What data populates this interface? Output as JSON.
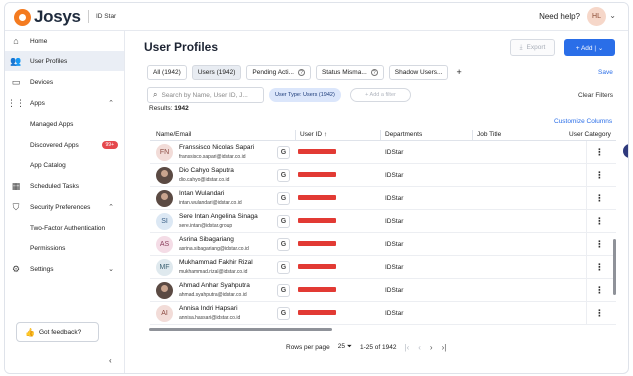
{
  "app": {
    "logo": "Josys",
    "tenant": "ID Star",
    "help": "Need help?",
    "avatar": "HL"
  },
  "sidebar": {
    "items": [
      {
        "label": "Home",
        "icon": "home-icon"
      },
      {
        "label": "User Profiles",
        "icon": "people-icon"
      },
      {
        "label": "Devices",
        "icon": "laptop-icon"
      },
      {
        "label": "Apps",
        "icon": "grid-icon"
      },
      {
        "label": "Managed Apps"
      },
      {
        "label": "Discovered Apps",
        "badge": "99+"
      },
      {
        "label": "App Catalog"
      },
      {
        "label": "Scheduled Tasks",
        "icon": "calendar-icon"
      },
      {
        "label": "Security Preferences",
        "icon": "shield-icon"
      },
      {
        "label": "Two-Factor Authentication"
      },
      {
        "label": "Permissions"
      },
      {
        "label": "Settings",
        "icon": "gear-icon"
      }
    ],
    "feedback": "Got feedback?"
  },
  "main": {
    "title": "User Profiles",
    "export_label": "Export",
    "add_label": "+ Add | ⌄",
    "tabs": [
      {
        "label": "All (1942)"
      },
      {
        "label": "Users (1942)"
      },
      {
        "label": "Pending Acti..."
      },
      {
        "label": "Status Misma..."
      },
      {
        "label": "Shadow Users..."
      }
    ],
    "save_label": "Save",
    "search_placeholder": "Search by Name, User ID, J...",
    "filter_chip": "User Type: Users (1942)",
    "add_filter": "+ Add a filter",
    "clear_filters": "Clear Filters",
    "results_label": "Results:",
    "results_count": "1942",
    "customize": "Customize Columns",
    "columns": [
      "Name/Email",
      "User ID ↑",
      "Departments",
      "Job Title",
      "User Category"
    ],
    "rows": [
      {
        "initials": "FN",
        "name": "Franssisco Nicolas Sapari",
        "email": "franssisco.sapari@idstar.co.id",
        "dept": "IDStar",
        "avatar_color": "#f2dcd8",
        "text_color": "#8b4a42"
      },
      {
        "initials": "",
        "name": "Dio Cahyo Saputra",
        "email": "dio.cahyo@idstar.co.id",
        "dept": "IDStar",
        "photo": true
      },
      {
        "initials": "",
        "name": "Intan Wulandari",
        "email": "intan.wulandari@idstar.co.id",
        "dept": "IDStar",
        "photo": true
      },
      {
        "initials": "SI",
        "name": "Sere Intan Angelina Sinaga",
        "email": "sere.intan@idstar.group",
        "dept": "IDStar",
        "avatar_color": "#dce8f4",
        "text_color": "#3a5f86"
      },
      {
        "initials": "AS",
        "name": "Asrina Sibagariang",
        "email": "asrina.sibagariang@idstar.co.id",
        "dept": "IDStar",
        "avatar_color": "#f4dce6",
        "text_color": "#8a3e5c"
      },
      {
        "initials": "MF",
        "name": "Mukhammad Fakhir Rizal",
        "email": "mukhammad.rizal@idstar.co.id",
        "dept": "IDStar",
        "avatar_color": "#dfe9ee",
        "text_color": "#3e6373"
      },
      {
        "initials": "",
        "name": "Ahmad Anhar Syahputra",
        "email": "ahmad.syahputra@idstar.co.id",
        "dept": "IDStar",
        "photo": true
      },
      {
        "initials": "AI",
        "name": "Annisa Indri Hapsari",
        "email": "annisa.hassari@idstar.co.id",
        "dept": "IDStar",
        "avatar_color": "#f2dcd8",
        "text_color": "#8b4a42"
      }
    ],
    "pager": {
      "rows_label": "Rows per page",
      "rows_value": "25 ⏷",
      "range": "1-25 of 1942"
    }
  }
}
